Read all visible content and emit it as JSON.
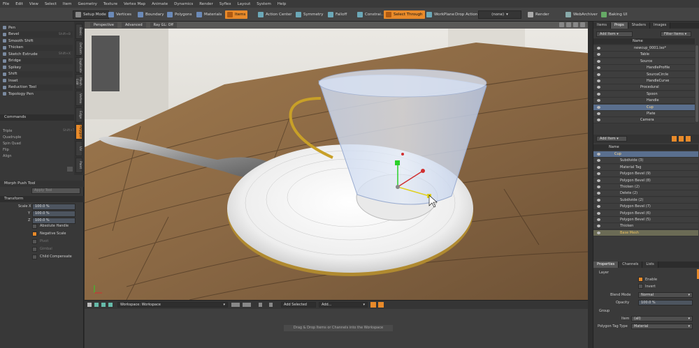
{
  "menu": [
    "File",
    "Edit",
    "View",
    "Select",
    "Item",
    "Geometry",
    "Texture",
    "Vertex Map",
    "Animate",
    "Dynamics",
    "Render",
    "Syflex",
    "Layout",
    "System",
    "Help"
  ],
  "toolbar": {
    "setup_mode": "Setup Mode",
    "vertices": "Vertices",
    "boundary": "Boundary",
    "polygons": "Polygons",
    "materials": "Materials",
    "items": "Items",
    "action_center": "Action Center",
    "symmetry": "Symmetry",
    "falloff": "Falloff",
    "constrain": "Constrai...",
    "select_through": "Select Through",
    "workplane": "WorkPlane",
    "drop_action": "Drop Action",
    "drop_value": "(none)",
    "render": "Render",
    "website": "WebArchiver",
    "baking": "Baking UI"
  },
  "tools": [
    {
      "label": "Pen",
      "shortcut": ""
    },
    {
      "label": "Bevel",
      "shortcut": "Shift+B"
    },
    {
      "label": "Smooth Shift",
      "shortcut": ""
    },
    {
      "label": "Thicken",
      "shortcut": ""
    },
    {
      "label": "Sketch Extrude",
      "shortcut": "Shift+X"
    },
    {
      "label": "Bridge",
      "shortcut": ""
    },
    {
      "label": "Spikey",
      "shortcut": ""
    },
    {
      "label": "Shift",
      "shortcut": ""
    },
    {
      "label": "Inset",
      "shortcut": ""
    },
    {
      "label": "Reduction Tool",
      "shortcut": ""
    },
    {
      "label": "Topology Pen",
      "shortcut": ""
    }
  ],
  "vtabs": [
    "Basic",
    "Deform",
    "Duplicate",
    "Mesh Edit",
    "Vertex",
    "Edge",
    "Polygon",
    "UV",
    "Paint"
  ],
  "commands_header": "Commands",
  "commands": [
    {
      "label": "Triple",
      "shortcut": "Shift+T"
    },
    {
      "label": "Quadruple",
      "shortcut": ""
    },
    {
      "label": "Spin Quad",
      "shortcut": ""
    },
    {
      "label": "Flip",
      "shortcut": ""
    },
    {
      "label": "Align",
      "shortcut": ""
    }
  ],
  "morph_header": "Morph Push Tool",
  "morph_apply": "Apply Tool",
  "transform_header": "Transform",
  "scale": [
    {
      "axis": "Scale X",
      "value": "100.0 %"
    },
    {
      "axis": "Y",
      "value": "100.0 %"
    },
    {
      "axis": "Z",
      "value": "100.0 %"
    }
  ],
  "options": [
    {
      "label": "Absolute Handle",
      "checked": false,
      "dim": false
    },
    {
      "label": "Negative Scale",
      "checked": true,
      "dim": false
    },
    {
      "label": "Pivot",
      "checked": false,
      "dim": true
    },
    {
      "label": "Gimbal",
      "checked": false,
      "dim": true
    },
    {
      "label": "Child Compensate",
      "checked": false,
      "dim": false
    }
  ],
  "viewport": {
    "views": [
      "Perspective",
      "Advanced",
      "Ray GL: Off"
    ]
  },
  "workspace": {
    "label": "Workspace: Workspace",
    "add_selected": "Add Selected",
    "add": "Add...",
    "hint": "Drag & Drop Items or Channels into the Workspace"
  },
  "items_panel": {
    "tabs": [
      "Items",
      "Props",
      "Shaders",
      "Images"
    ],
    "add_item": "Add Item",
    "filter": "Filter Items",
    "col_name": "Name",
    "tree": [
      {
        "label": "newcup_0001.lxo*",
        "indent": 0,
        "sel": false
      },
      {
        "label": "Table",
        "indent": 1,
        "sel": false
      },
      {
        "label": "Source",
        "indent": 1,
        "sel": false
      },
      {
        "label": "HandleProfile",
        "indent": 2,
        "sel": false
      },
      {
        "label": "SourceCircle",
        "indent": 2,
        "sel": false
      },
      {
        "label": "HandleCurve",
        "indent": 2,
        "sel": false
      },
      {
        "label": "Procedural",
        "indent": 1,
        "sel": false
      },
      {
        "label": "Spoon",
        "indent": 2,
        "sel": false
      },
      {
        "label": "Handle",
        "indent": 2,
        "sel": false
      },
      {
        "label": "Cup",
        "indent": 2,
        "sel": true
      },
      {
        "label": "Plate",
        "indent": 2,
        "sel": false
      },
      {
        "label": "Camera",
        "indent": 1,
        "sel": false
      }
    ]
  },
  "mesh_ops": {
    "add_item": "Add Item",
    "col_name": "Name",
    "list": [
      {
        "label": "Cup",
        "state": "sel"
      },
      {
        "label": "Subdivide (3)",
        "state": ""
      },
      {
        "label": "Material Tag",
        "state": ""
      },
      {
        "label": "Polygon Bevel (9)",
        "state": ""
      },
      {
        "label": "Polygon Bevel (8)",
        "state": ""
      },
      {
        "label": "Thicken (2)",
        "state": ""
      },
      {
        "label": "Delete (2)",
        "state": ""
      },
      {
        "label": "Subdivide (2)",
        "state": ""
      },
      {
        "label": "Polygon Bevel (7)",
        "state": ""
      },
      {
        "label": "Polygon Bevel (6)",
        "state": ""
      },
      {
        "label": "Polygon Bevel (5)",
        "state": ""
      },
      {
        "label": "Thicken",
        "state": ""
      },
      {
        "label": "Base Mesh",
        "state": "hl"
      }
    ]
  },
  "properties": {
    "tabs": [
      "Properties",
      "Channels",
      "Lists"
    ],
    "layer_header": "Layer",
    "enable": "Enable",
    "invert": "Invert",
    "blend_mode_label": "Blend Mode",
    "blend_mode": "Normal",
    "opacity_label": "Opacity",
    "opacity": "100.0 %",
    "group_header": "Group",
    "item_label": "Item",
    "item_value": "(all)",
    "ptag_label": "Polygon Tag Type",
    "ptag_value": "Material"
  },
  "colors": {
    "accent": "#e88a2a",
    "selected": "#5a6f8e",
    "panel": "#383838"
  }
}
